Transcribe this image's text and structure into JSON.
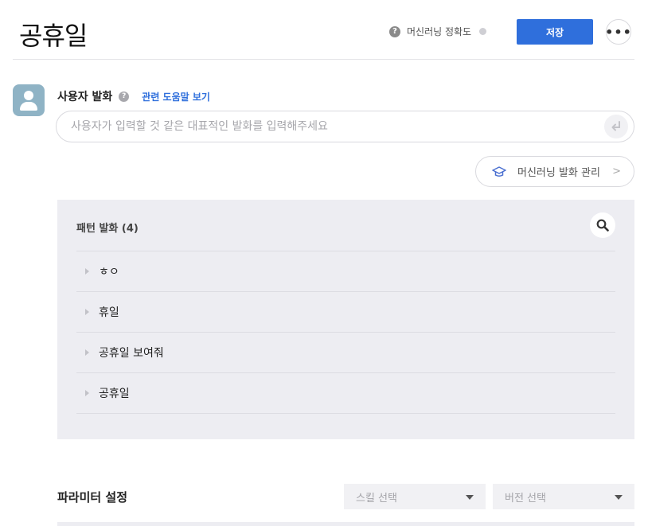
{
  "page": {
    "title": "공휴일"
  },
  "header": {
    "accuracy_label": "머신러닝 정확도",
    "help_icon": "question-circle-icon",
    "status_color": "#cfcfd4",
    "save_label": "저장",
    "more_icon": "more-horizontal-icon",
    "more_glyph": "•••"
  },
  "colors": {
    "accent": "#2f6fdc",
    "panel_bg": "#ededf2",
    "avatar_bg": "#8fb3c5"
  },
  "utterance": {
    "title": "사용자 발화",
    "help_link": "관련 도움말 보기",
    "placeholder": "사용자가 입력할 것 같은 대표적인 발화를 입력해주세요",
    "value": "",
    "enter_icon": "enter-return-icon"
  },
  "ml_manage": {
    "label": "머신러닝 발화 관리",
    "icon": "graduation-cap-icon"
  },
  "patterns": {
    "title": "패턴 발화 (4)",
    "search_icon": "search-icon",
    "items": [
      {
        "text": "ㅎㅇ"
      },
      {
        "text": "휴일"
      },
      {
        "text": "공휴일 보여줘"
      },
      {
        "text": "공휴일"
      }
    ]
  },
  "parameters": {
    "title": "파라미터 설정",
    "skill_select": {
      "value": "스킬 선택"
    },
    "version_select": {
      "value": "버전 선택"
    }
  }
}
